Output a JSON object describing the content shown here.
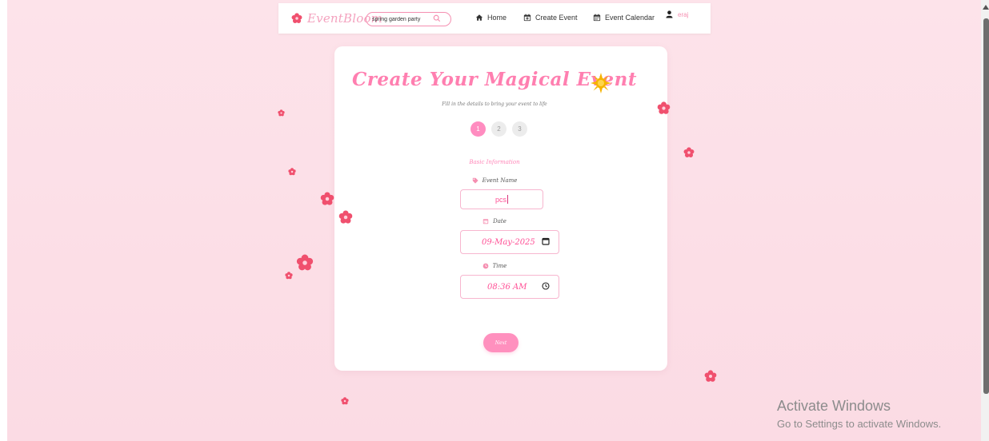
{
  "brand": {
    "name": "EventBloom"
  },
  "search": {
    "value": "spring garden party"
  },
  "nav": {
    "home": "Home",
    "create": "Create Event",
    "calendar": "Event Calendar",
    "user": "eraj"
  },
  "form": {
    "title": "Create Your Magical Event",
    "subtitle": "Fill in the details to bring your event to life",
    "steps": [
      "1",
      "2",
      "3"
    ],
    "active_step": 1,
    "section_title": "Basic Information",
    "event_name_label": "Event Name",
    "event_name_value": "pcs",
    "date_label": "Date",
    "date_value": "09-May-2025",
    "time_label": "Time",
    "time_value": "08:36 AM",
    "next_label": "Next"
  },
  "system": {
    "activate_title": "Activate Windows",
    "activate_sub": "Go to Settings to activate Windows."
  },
  "colors": {
    "accent": "#ff7fb0",
    "background": "#fde4ea",
    "flower": "#f0506e"
  }
}
